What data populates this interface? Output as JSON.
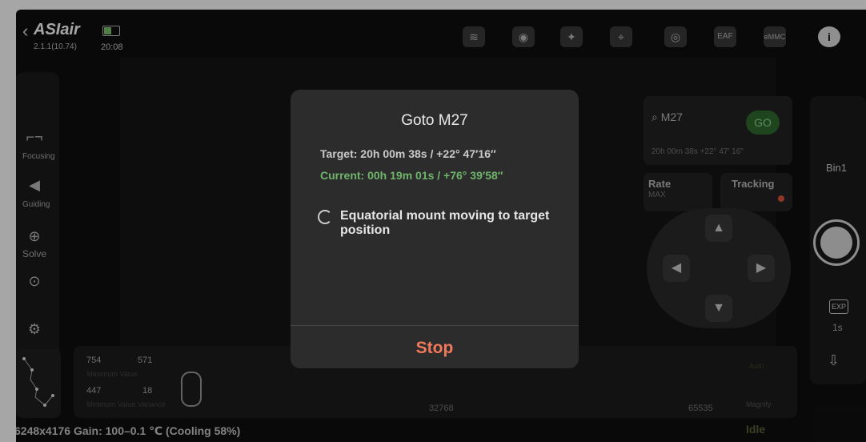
{
  "topbar": {
    "back_icon": "chevron-left-icon",
    "logo": "ASIair",
    "version": "2.1.1(10.74)",
    "time": "20:08",
    "icons": [
      "wifi-icon",
      "camera-icon",
      "mount-icon",
      "telescope-icon",
      "filter-wheel-icon",
      "eaf-icon",
      "emmc-icon",
      "info-icon"
    ],
    "icon_labels": [
      "",
      "",
      "",
      "",
      "",
      "EAF",
      "eMMC",
      "i"
    ]
  },
  "left_rail": {
    "items": [
      "Focusing",
      "Guiding",
      "Solve"
    ]
  },
  "histogram": {
    "max_value": "754",
    "min_value": "447",
    "max_value2": "571",
    "variance": "18",
    "max_label": "Maximum Value",
    "min_label": "Minimum Value Variance",
    "axis_mid": "32768",
    "axis_max": "65535",
    "auto": "Auto",
    "magnify": "Magnify"
  },
  "status": {
    "info": "6248x4176 Gain: 100–0.1 ℃ (Cooling 58%)",
    "state": "Idle"
  },
  "right_rail": {
    "bin": "Bin1",
    "exp_label": "EXP",
    "exp_value": "1s"
  },
  "mount_panel": {
    "search_value": "M27",
    "go_label": "GO",
    "coords": "20h 00m 38s  +22° 47' 16\"",
    "rate_label": "Rate",
    "rate_value": "MAX",
    "tracking_label": "Tracking"
  },
  "dialog": {
    "title": "Goto M27",
    "target": "Target: 20h 00m 38s / +22° 47′16″",
    "current": "Current: 00h 19m 01s / +76° 39′58″",
    "status": "Equatorial mount moving to target position",
    "stop_label": "Stop",
    "colors": {
      "current": "#6fb56b",
      "stop": "#f07a5b"
    }
  }
}
